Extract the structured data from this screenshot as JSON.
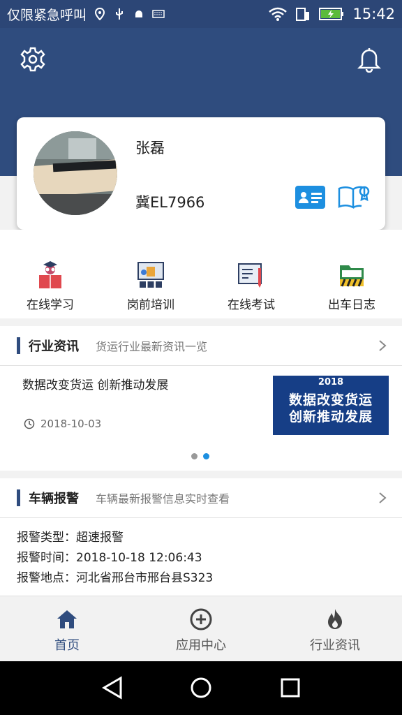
{
  "status_bar": {
    "carrier_text": "仅限紧急呼叫",
    "time": "15:42"
  },
  "header": {
    "settings_icon": "gear-icon",
    "notification_icon": "bell-icon"
  },
  "profile": {
    "name": "张磊",
    "plate": "冀EL7966",
    "id_card_icon": "id-card-icon",
    "certificate_icon": "book-certificate-icon"
  },
  "quick_actions": [
    {
      "label": "在线学习",
      "icon": "online-study-icon"
    },
    {
      "label": "岗前培训",
      "icon": "training-icon"
    },
    {
      "label": "在线考试",
      "icon": "exam-icon"
    },
    {
      "label": "出车日志",
      "icon": "log-folder-icon"
    }
  ],
  "news_section": {
    "title": "行业资讯",
    "subtitle": "货运行业最新资讯一览",
    "item": {
      "title": "数据改变货运 创新推动发展",
      "date": "2018-10-03",
      "image": {
        "line1": "2018",
        "line2": "数据改变货运",
        "line3": "创新推动发展"
      }
    },
    "carousel": {
      "count": 2,
      "active_index": 1
    }
  },
  "alarm_section": {
    "title": "车辆报警",
    "subtitle": "车辆最新报警信息实时查看",
    "type_line": "报警类型：超速报警",
    "time_line": "报警时间：2018-10-18 12:06:43",
    "location_line": "报警地点：河北省邢台市邢台县S323"
  },
  "tabbar": [
    {
      "label": "首页",
      "icon": "home-icon",
      "active": true
    },
    {
      "label": "应用中心",
      "icon": "plus-circle-icon",
      "active": false
    },
    {
      "label": "行业资讯",
      "icon": "flame-icon",
      "active": false
    }
  ],
  "colors": {
    "header_bg": "#2f4c7e",
    "accent_blue": "#1d8fe0",
    "active_tab": "#2f4c7e"
  }
}
